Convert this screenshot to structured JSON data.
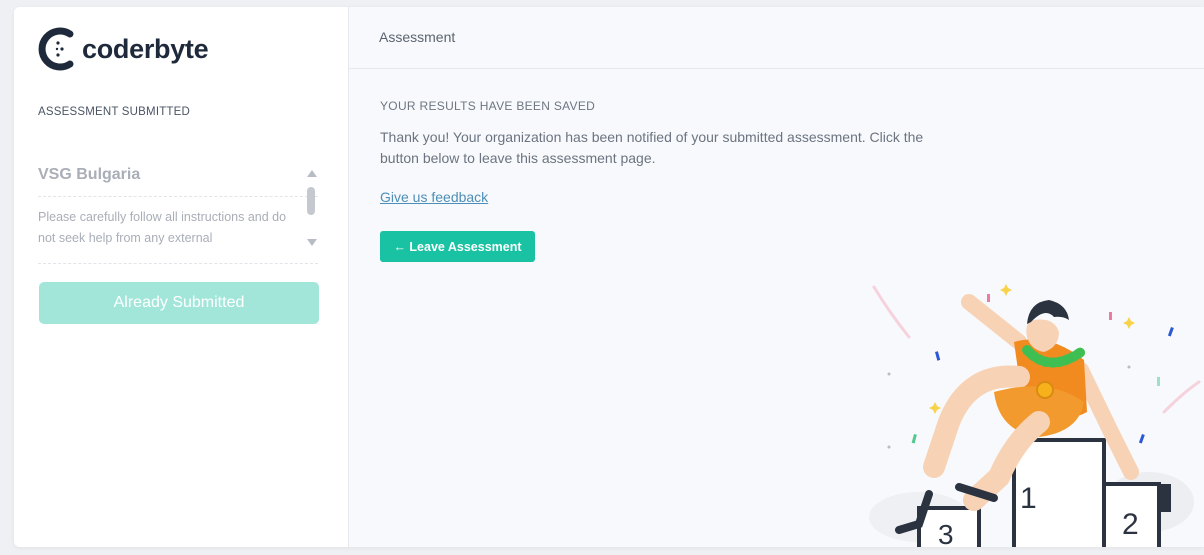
{
  "brand": {
    "name": "coderbyte",
    "accent": "#19c2a2",
    "dark": "#1e2a3b"
  },
  "sidebar": {
    "section_label": "ASSESSMENT SUBMITTED",
    "org_name": "VSG Bulgaria",
    "instructions": "Please carefully follow all instructions and do not seek help from any external",
    "submit_button": "Already Submitted"
  },
  "header": {
    "title": "Assessment"
  },
  "main": {
    "results_label": "YOUR RESULTS HAVE BEEN SAVED",
    "thanks_text": "Thank you! Your organization has been notified of your submitted assessment. Click the button below to leave this assessment page.",
    "feedback_link": "Give us feedback",
    "leave_button": "← Leave Assessment"
  },
  "illustration": {
    "podium_labels": [
      "1",
      "2",
      "3"
    ]
  }
}
